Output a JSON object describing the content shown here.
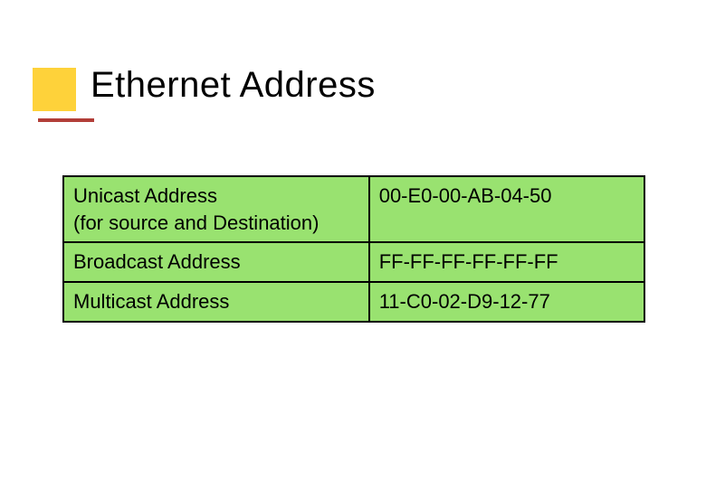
{
  "title": "Ethernet Address",
  "table": {
    "rows": [
      {
        "label_line1": "Unicast Address",
        "label_line2": "(for source and Destination)",
        "value": "00-E0-00-AB-04-50"
      },
      {
        "label_line1": "Broadcast Address",
        "label_line2": "",
        "value": "FF-FF-FF-FF-FF-FF"
      },
      {
        "label_line1": "Multicast Address",
        "label_line2": "",
        "value": "11-C0-02-D9-12-77"
      }
    ]
  }
}
